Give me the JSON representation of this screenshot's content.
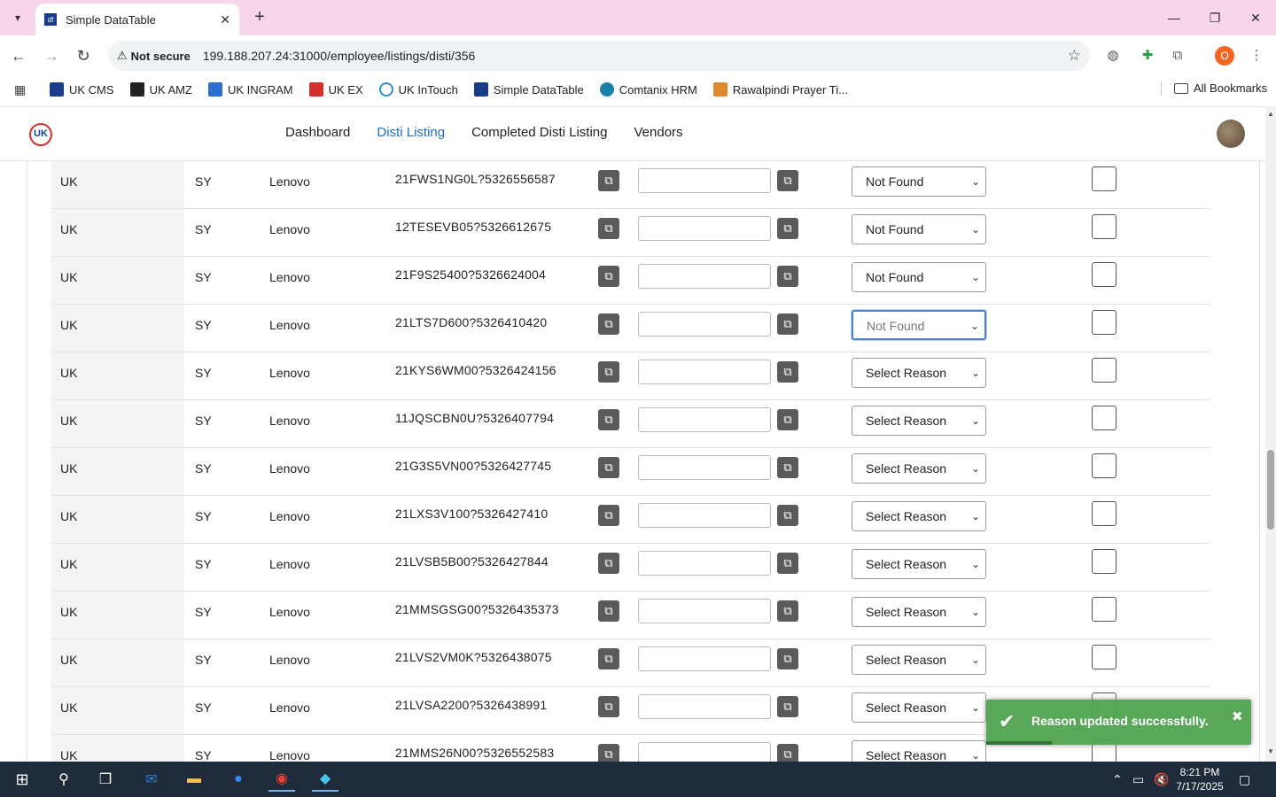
{
  "browser": {
    "tab_title": "Simple DataTable",
    "tab_favicon": "df",
    "not_secure": "Not secure",
    "url": "199.188.207.24:31000/employee/listings/disti/356",
    "profile_initial": "O",
    "bookmarks": [
      "UK CMS",
      "UK AMZ",
      "UK INGRAM",
      "UK EX",
      "UK InTouch",
      "Simple DataTable",
      "Comtanix HRM",
      "Rawalpindi Prayer Ti..."
    ],
    "all_bookmarks": "All Bookmarks"
  },
  "app": {
    "logo_text": "UK",
    "nav": [
      "Dashboard",
      "Disti Listing",
      "Completed Disti Listing",
      "Vendors"
    ]
  },
  "rows": [
    {
      "region": "UK",
      "code": "SY",
      "brand": "Lenovo",
      "sku": "21FWS1NG0L?5326556587",
      "reason": "Not Found"
    },
    {
      "region": "UK",
      "code": "SY",
      "brand": "Lenovo",
      "sku": "12TESEVB05?5326612675",
      "reason": "Not Found"
    },
    {
      "region": "UK",
      "code": "SY",
      "brand": "Lenovo",
      "sku": "21F9S25400?5326624004",
      "reason": "Not Found"
    },
    {
      "region": "UK",
      "code": "SY",
      "brand": "Lenovo",
      "sku": "21LTS7D600?5326410420",
      "reason": "Not Found"
    },
    {
      "region": "UK",
      "code": "SY",
      "brand": "Lenovo",
      "sku": "21KYS6WM00?5326424156",
      "reason": "Select Reason"
    },
    {
      "region": "UK",
      "code": "SY",
      "brand": "Lenovo",
      "sku": "11JQSCBN0U?5326407794",
      "reason": "Select Reason"
    },
    {
      "region": "UK",
      "code": "SY",
      "brand": "Lenovo",
      "sku": "21G3S5VN00?5326427745",
      "reason": "Select Reason"
    },
    {
      "region": "UK",
      "code": "SY",
      "brand": "Lenovo",
      "sku": "21LXS3V100?5326427410",
      "reason": "Select Reason"
    },
    {
      "region": "UK",
      "code": "SY",
      "brand": "Lenovo",
      "sku": "21LVSB5B00?5326427844",
      "reason": "Select Reason"
    },
    {
      "region": "UK",
      "code": "SY",
      "brand": "Lenovo",
      "sku": "21MMSGSG00?5326435373",
      "reason": "Select Reason"
    },
    {
      "region": "UK",
      "code": "SY",
      "brand": "Lenovo",
      "sku": "21LVS2VM0K?5326438075",
      "reason": "Select Reason"
    },
    {
      "region": "UK",
      "code": "SY",
      "brand": "Lenovo",
      "sku": "21LVSA2200?5326438991",
      "reason": "Select Reason"
    },
    {
      "region": "UK",
      "code": "SY",
      "brand": "Lenovo",
      "sku": "21MMS26N00?5326552583",
      "reason": "Select Reason"
    }
  ],
  "toast": {
    "message": "Reason updated successfully.",
    "color": "#51a351"
  },
  "taskbar": {
    "time": "8:21 PM",
    "date": "7/17/2025"
  },
  "colors": {
    "tabstrip": "#f8d6ea",
    "nav_active": "#1f6fc6"
  }
}
